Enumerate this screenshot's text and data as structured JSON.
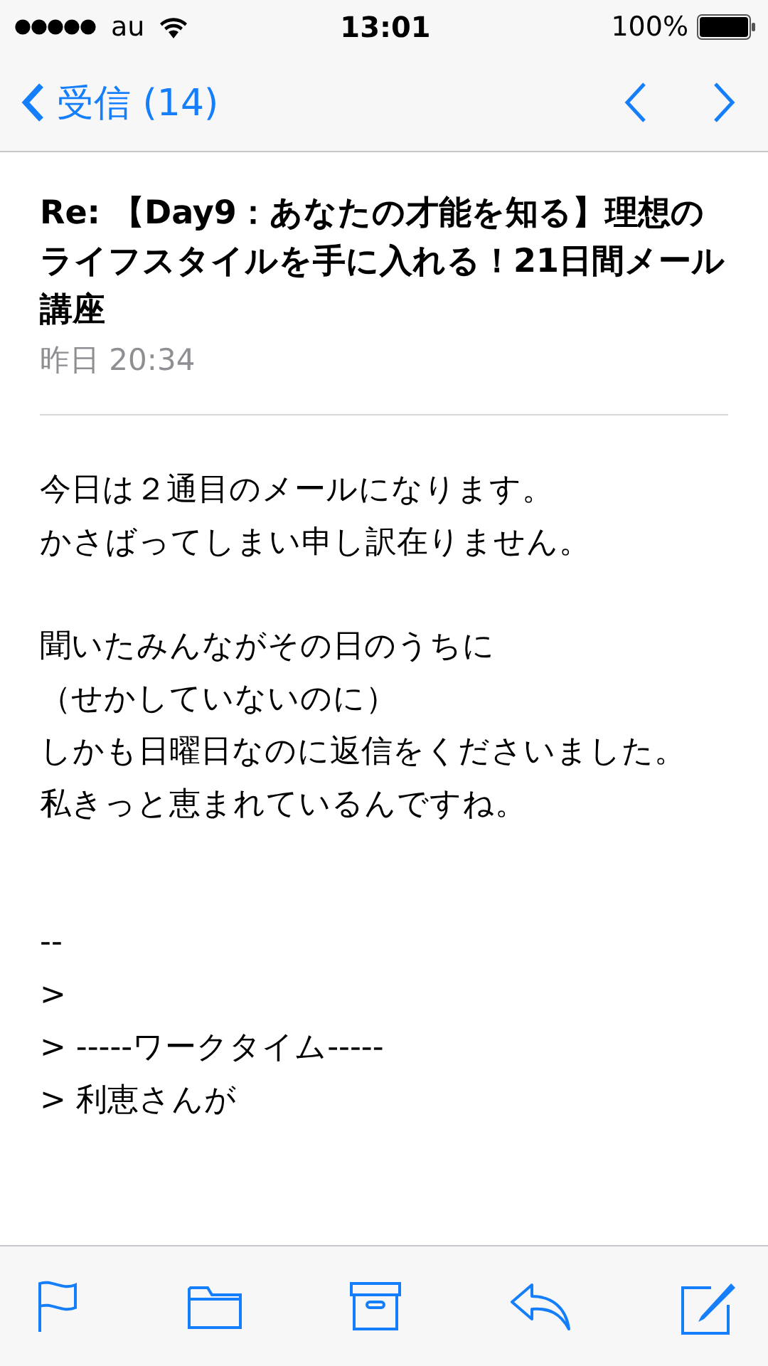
{
  "status_bar": {
    "carrier": "au",
    "time": "13:01",
    "battery": "100%"
  },
  "nav": {
    "back": "受信 (14)"
  },
  "message": {
    "subject": "Re: 【Day9：あなたの才能を知る】理想のライフスタイルを手に入れる！21日間メール講座",
    "date": "昨日 20:34",
    "paragraphs": [
      [
        "今日は２通目のメールになります。",
        "かさばってしまい申し訳在りません。"
      ],
      [
        "聞いたみんながその日のうちに",
        "（せかしていないのに）",
        "しかも日曜日なのに返信をくださいました。",
        "私きっと恵まれているんですね。"
      ]
    ],
    "quote": [
      "--",
      ">",
      "> -----ワークタイム-----",
      "> 利恵さんが"
    ]
  }
}
